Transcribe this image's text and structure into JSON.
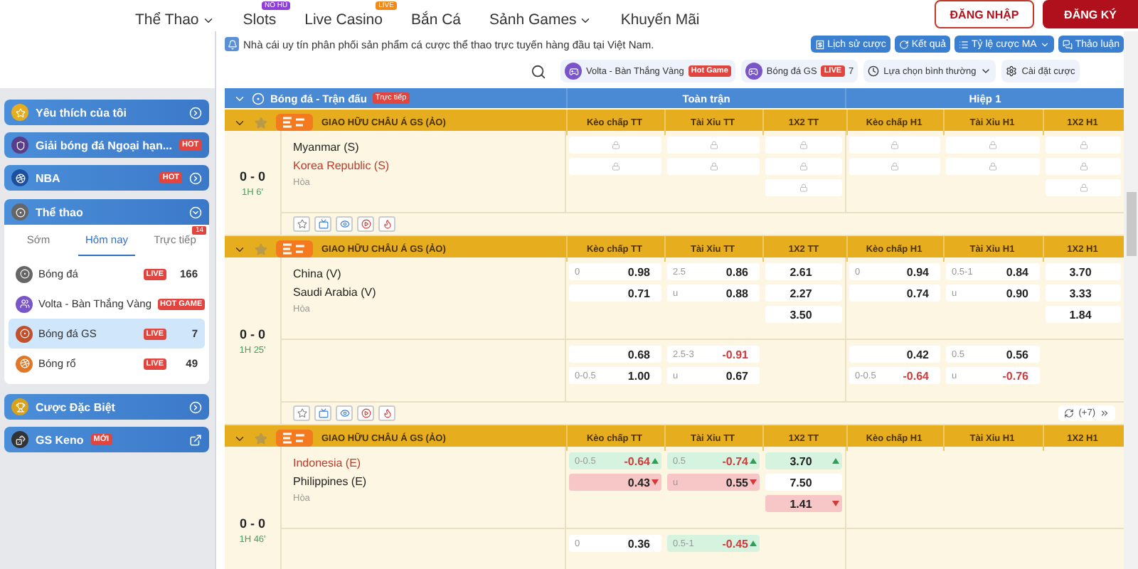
{
  "nav": [
    {
      "label": "Thể Thao",
      "dropdown": true
    },
    {
      "label": "Slots",
      "kind": "jackpot",
      "dropdown": false,
      "badge": "NỔ HŨ"
    },
    {
      "label": "Live Casino",
      "kind": "live",
      "dropdown": false,
      "badge": "LIVE"
    },
    {
      "label": "Bắn Cá",
      "dropdown": false
    },
    {
      "label": "Sảnh Games",
      "dropdown": true
    },
    {
      "label": "Khuyến Mãi",
      "dropdown": false
    }
  ],
  "auth": {
    "login": "ĐĂNG NHẬP",
    "register": "ĐĂNG KÝ"
  },
  "marquee": "Nhà cái uy tín phân phối sản phẩm cá cược thể thao trực tuyến hàng đầu tại Việt Nam.",
  "tools": [
    {
      "label": "Lịch sử cược",
      "kind": "history"
    },
    {
      "label": "Kết quả",
      "kind": "results"
    },
    {
      "label": "Tỷ lệ cược MA",
      "kind": "odds"
    },
    {
      "label": "Thảo luận",
      "kind": "chat"
    }
  ],
  "sidebar": {
    "top_items": [
      {
        "label": "Yêu thích của tôi",
        "kind": "star"
      },
      {
        "label": "Giải bóng đá Ngoại hạn...",
        "kind": "league",
        "badge": "HOT"
      },
      {
        "label": "NBA",
        "kind": "nba",
        "badge": "HOT"
      }
    ],
    "sports": {
      "title": "Thể thao",
      "tabs": [
        {
          "label": "Sớm",
          "selected": false
        },
        {
          "label": "Hôm nay",
          "selected": true
        },
        {
          "label": "Trực tiếp",
          "selected": false,
          "badge": "14"
        }
      ],
      "items": [
        {
          "label": "Bóng đá",
          "kind": "soccer",
          "badge": "LIVE",
          "count": "166",
          "selected": false
        },
        {
          "label": "Volta - Bàn Thắng Vàng",
          "kind": "volta",
          "badge": "HOT GAME",
          "selected": false
        },
        {
          "label": "Bóng đá GS",
          "kind": "gs",
          "badge": "LIVE",
          "count": "7",
          "selected": true
        },
        {
          "label": "Bóng rổ",
          "kind": "basketball",
          "badge": "LIVE",
          "count": "49",
          "selected": false
        }
      ]
    },
    "bottom_items": [
      {
        "label": "Cược Đặc Biệt",
        "kind": "trophy"
      },
      {
        "label": "GS Keno",
        "kind": "keno",
        "badge": "MỚI"
      }
    ]
  },
  "subtabs": [
    {
      "label": "Volta - Bàn Thắng Vàng",
      "kind": "game",
      "badge": "Hot Game"
    },
    {
      "label": "Bóng đá GS",
      "kind": "game",
      "badge": "LIVE",
      "count": "7"
    },
    {
      "label": "Lựa chọn bình thường",
      "kind": "select"
    },
    {
      "label": "Cài đặt cược",
      "kind": "settings"
    }
  ],
  "table": {
    "title": "Bóng đá - Trận đấu",
    "badge": "Trực tiếp",
    "groups": [
      "Toàn trận",
      "Hiệp 1"
    ],
    "matches": [
      {
        "league": "GIAO HỮU CHÂU Á GS (ẢO)",
        "favorite": false,
        "columns": [
          "Kèo chấp TT",
          "Tài Xỉu TT",
          "1X2 TT",
          "Kèo chấp H1",
          "Tài Xỉu H1",
          "1X2 H1"
        ],
        "teams": [
          {
            "name": "Myanmar (S)",
            "highlighted": false
          },
          {
            "name": "Korea Republic (S)",
            "highlighted": true
          }
        ],
        "draw": "Hòa",
        "score": "0 - 0",
        "clock": "1H 6'",
        "lines": [
          {
            "markets": {
              "handicap_ft": [
                {
                  "kind": "locked"
                },
                {
                  "kind": "locked"
                }
              ],
              "total_ft": [
                {
                  "kind": "locked"
                },
                {
                  "kind": "locked"
                }
              ],
              "x12_ft": [
                {
                  "kind": "locked"
                },
                {
                  "kind": "locked"
                },
                {
                  "kind": "locked"
                }
              ],
              "handicap_h1": [
                {
                  "kind": "locked"
                },
                {
                  "kind": "locked"
                }
              ],
              "total_h1": [
                {
                  "kind": "locked"
                },
                {
                  "kind": "locked"
                }
              ],
              "x12_h1": [
                {
                  "kind": "locked"
                },
                {
                  "kind": "locked"
                },
                {
                  "kind": "locked"
                }
              ]
            }
          }
        ]
      },
      {
        "league": "GIAO HỮU CHÂU Á GS (ẢO)",
        "favorite": false,
        "columns": [
          "Kèo chấp TT",
          "Tài Xỉu TT",
          "1X2 TT",
          "Kèo chấp H1",
          "Tài Xỉu H1",
          "1X2 H1"
        ],
        "teams": [
          {
            "name": "China (V)",
            "highlighted": false
          },
          {
            "name": "Saudi Arabia (V)",
            "highlighted": false
          }
        ],
        "draw": "Hòa",
        "score": "0 - 0",
        "clock": "1H 25'",
        "extra": "(+7)",
        "lines": [
          {
            "markets": {
              "handicap_ft": [
                {
                  "kind": "price",
                  "line": "0",
                  "price": "0.98",
                  "negative": false
                },
                {
                  "kind": "price",
                  "price": "0.71",
                  "negative": false
                }
              ],
              "total_ft": [
                {
                  "kind": "price",
                  "line": "2.5",
                  "price": "0.86",
                  "negative": false
                },
                {
                  "kind": "price",
                  "line": "u",
                  "price": "0.88",
                  "negative": false
                }
              ],
              "x12_ft": [
                {
                  "kind": "price",
                  "price": "2.61",
                  "negative": false
                },
                {
                  "kind": "price",
                  "price": "2.27",
                  "negative": false
                },
                {
                  "kind": "price",
                  "price": "3.50",
                  "negative": false
                }
              ],
              "handicap_h1": [
                {
                  "kind": "price",
                  "line": "0",
                  "price": "0.94",
                  "negative": false
                },
                {
                  "kind": "price",
                  "price": "0.74",
                  "negative": false
                }
              ],
              "total_h1": [
                {
                  "kind": "price",
                  "line": "0.5-1",
                  "price": "0.84",
                  "negative": false
                },
                {
                  "kind": "price",
                  "line": "u",
                  "price": "0.90",
                  "negative": false
                }
              ],
              "x12_h1": [
                {
                  "kind": "price",
                  "price": "3.70",
                  "negative": false
                },
                {
                  "kind": "price",
                  "price": "3.33",
                  "negative": false
                },
                {
                  "kind": "price",
                  "price": "1.84",
                  "negative": false
                }
              ]
            }
          },
          {
            "markets": {
              "handicap_ft": [
                {
                  "kind": "price",
                  "price": "0.68",
                  "negative": false
                },
                {
                  "kind": "price",
                  "line": "0-0.5",
                  "price": "1.00",
                  "negative": false
                }
              ],
              "total_ft": [
                {
                  "kind": "price",
                  "line": "2.5-3",
                  "price": "-0.91",
                  "negative": true
                },
                {
                  "kind": "price",
                  "line": "u",
                  "price": "0.67",
                  "negative": false
                }
              ],
              "handicap_h1": [
                {
                  "kind": "price",
                  "price": "0.42",
                  "negative": false
                },
                {
                  "kind": "price",
                  "line": "0-0.5",
                  "price": "-0.64",
                  "negative": true
                }
              ],
              "total_h1": [
                {
                  "kind": "price",
                  "line": "0.5",
                  "price": "0.56",
                  "negative": false
                },
                {
                  "kind": "price",
                  "line": "u",
                  "price": "-0.76",
                  "negative": true
                }
              ]
            }
          }
        ]
      },
      {
        "league": "GIAO HỮU CHÂU Á GS (ẢO)",
        "favorite": false,
        "columns": [
          "Kèo chấp TT",
          "Tài Xỉu TT",
          "1X2 TT",
          "Kèo chấp H1",
          "Tài Xỉu H1",
          "1X2 H1"
        ],
        "teams": [
          {
            "name": "Indonesia (E)",
            "highlighted": true
          },
          {
            "name": "Philippines (E)",
            "highlighted": false
          }
        ],
        "draw": "Hòa",
        "score": "0 - 0",
        "clock": "1H 46'",
        "lines": [
          {
            "markets": {
              "handicap_ft": [
                {
                  "kind": "price_up",
                  "line": "0-0.5",
                  "price": "-0.64",
                  "negative": true
                },
                {
                  "kind": "price_down",
                  "price": "0.43",
                  "negative": false
                }
              ],
              "total_ft": [
                {
                  "kind": "price_up",
                  "line": "0.5",
                  "price": "-0.74",
                  "negative": true
                },
                {
                  "kind": "price_down",
                  "line": "u",
                  "price": "0.55",
                  "negative": false
                }
              ],
              "x12_ft": [
                {
                  "kind": "price_up",
                  "price": "3.70",
                  "negative": false
                },
                {
                  "kind": "price",
                  "price": "7.50",
                  "negative": false
                },
                {
                  "kind": "price_down",
                  "price": "1.41",
                  "negative": false
                }
              ]
            }
          },
          {
            "markets": {
              "handicap_ft": [
                {
                  "kind": "price",
                  "line": "0",
                  "price": "0.36",
                  "negative": false
                }
              ],
              "total_ft": [
                {
                  "kind": "price_up",
                  "line": "0.5-1",
                  "price": "-0.45",
                  "negative": true
                }
              ]
            }
          }
        ]
      }
    ]
  }
}
